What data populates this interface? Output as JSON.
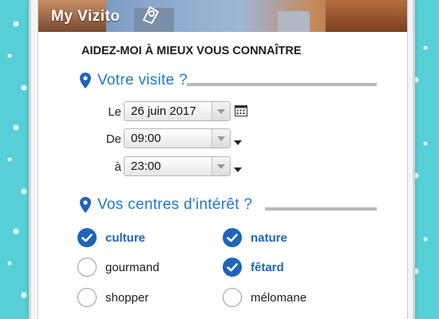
{
  "app": {
    "brand": "My Vizito"
  },
  "heading": "AIDEZ-MOI À MIEUX VOUS CONNAÎTRE",
  "visit": {
    "title": "Votre visite ?",
    "date_label": "Le",
    "date_value": "26 juin 2017",
    "from_label": "De",
    "from_value": "09:00",
    "to_label": "à",
    "to_value": "23:00"
  },
  "interests": {
    "title": "Vos centres d'intérêt ?",
    "options": [
      {
        "label": "culture",
        "checked": true
      },
      {
        "label": "nature",
        "checked": true
      },
      {
        "label": "gourmand",
        "checked": false
      },
      {
        "label": "fêtard",
        "checked": true
      },
      {
        "label": "shopper",
        "checked": false
      },
      {
        "label": "mélomane",
        "checked": false
      }
    ]
  },
  "colors": {
    "accent": "#1f64b8",
    "title_blue": "#1f78c8",
    "background": "#56cfd6"
  }
}
